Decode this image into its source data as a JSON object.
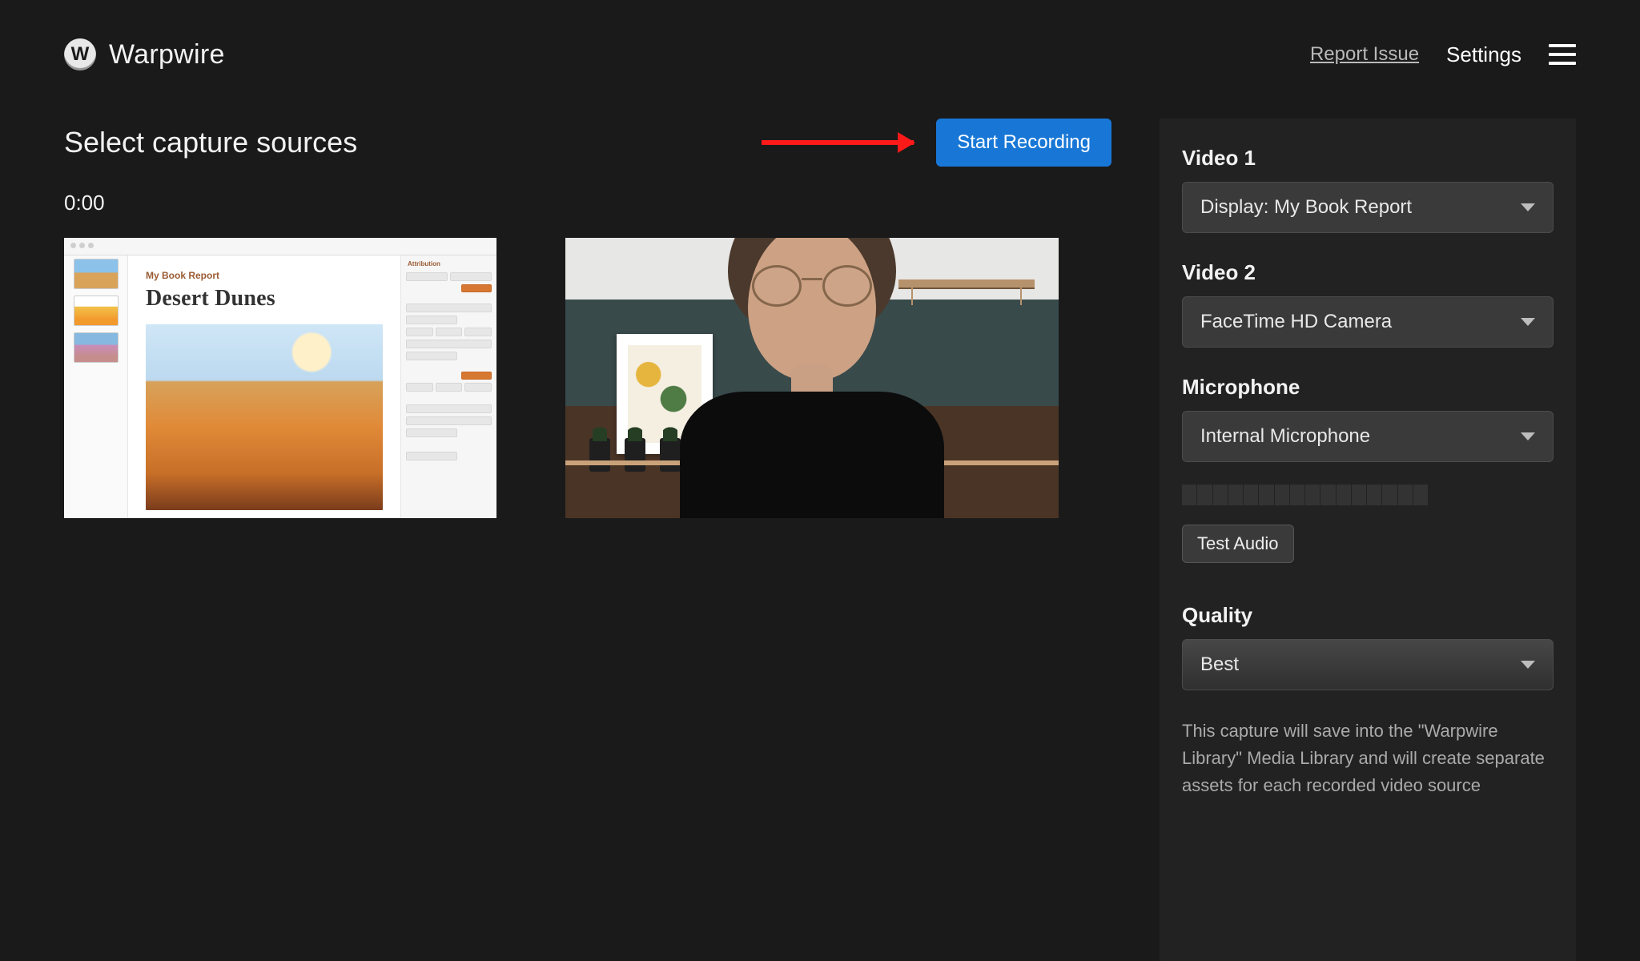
{
  "brand": {
    "logo_letter": "W",
    "name": "Warpwire"
  },
  "header": {
    "report_issue": "Report Issue",
    "settings": "Settings"
  },
  "left": {
    "title": "Select capture sources",
    "start_button": "Start Recording",
    "timer": "0:00",
    "screen_share": {
      "subtitle": "My Book Report",
      "title": "Desert Dunes",
      "side_panel_header": "Attribution"
    }
  },
  "panel": {
    "video1": {
      "label": "Video 1",
      "value": "Display: My Book Report"
    },
    "video2": {
      "label": "Video 2",
      "value": "FaceTime HD Camera"
    },
    "microphone": {
      "label": "Microphone",
      "value": "Internal Microphone"
    },
    "test_audio": "Test Audio",
    "quality": {
      "label": "Quality",
      "value": "Best"
    },
    "note": "This capture will save into the \"Warpwire Library\" Media Library and will create separate assets for each recorded video source"
  }
}
